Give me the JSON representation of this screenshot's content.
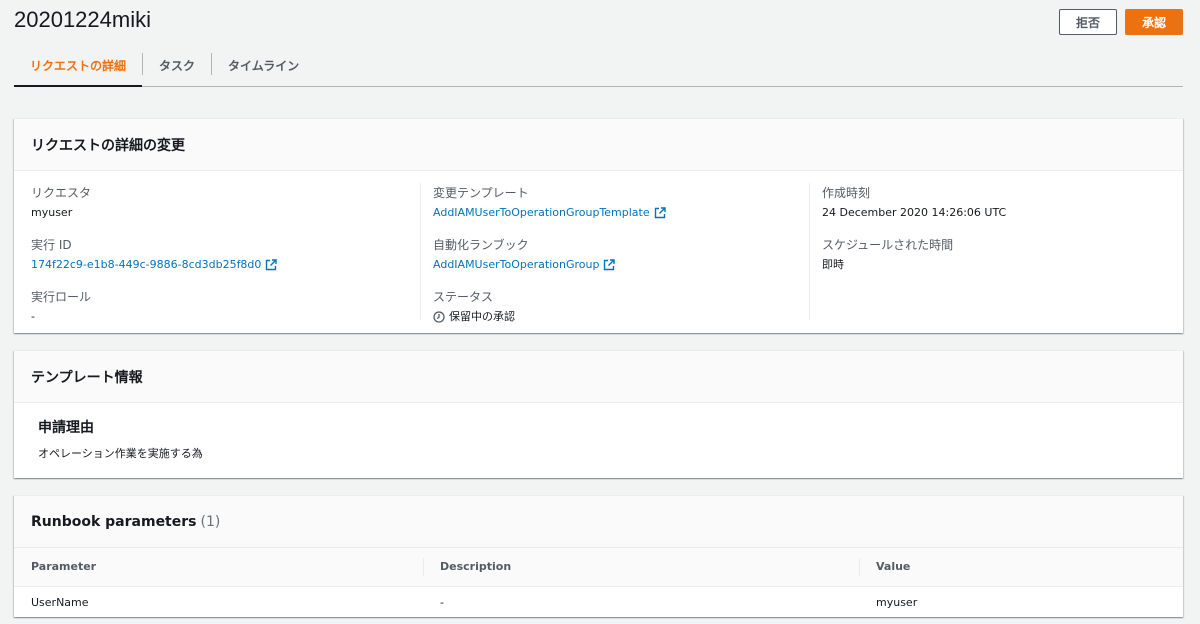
{
  "header": {
    "title": "20201224miki",
    "reject_label": "拒否",
    "approve_label": "承認"
  },
  "tabs": [
    {
      "label": "リクエストの詳細",
      "active": true
    },
    {
      "label": "タスク",
      "active": false
    },
    {
      "label": "タイムライン",
      "active": false
    }
  ],
  "details": {
    "title": "リクエストの詳細の変更",
    "requester_label": "リクエスタ",
    "requester_value": "myuser",
    "execution_id_label": "実行 ID",
    "execution_id_value": "174f22c9-e1b8-449c-9886-8cd3db25f8d0",
    "execution_role_label": "実行ロール",
    "execution_role_value": "-",
    "change_template_label": "変更テンプレート",
    "change_template_value": "AddIAMUserToOperationGroupTemplate",
    "runbook_label": "自動化ランブック",
    "runbook_value": "AddIAMUserToOperationGroup",
    "status_label": "ステータス",
    "status_value": "保留中の承認",
    "created_label": "作成時刻",
    "created_value": "24 December 2020 14:26:06 UTC",
    "scheduled_label": "スケジュールされた時間",
    "scheduled_value": "即時"
  },
  "template": {
    "title": "テンプレート情報",
    "reason_title": "申請理由",
    "reason_text": "オペレーション作業を実施する為"
  },
  "runbook": {
    "title": "Runbook parameters",
    "count": "(1)",
    "columns": [
      "Parameter",
      "Description",
      "Value"
    ],
    "rows": [
      [
        "UserName",
        "-",
        "myuser"
      ]
    ]
  },
  "icons": {
    "external": "external-link-icon",
    "clock": "clock-icon"
  },
  "colors": {
    "accent": "#ec7211",
    "link": "#0073bb"
  }
}
